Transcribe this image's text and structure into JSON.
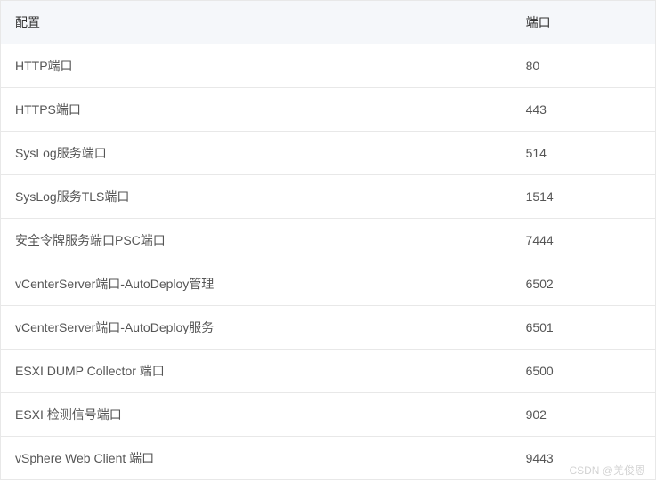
{
  "table": {
    "headers": {
      "config": "配置",
      "port": "端口"
    },
    "rows": [
      {
        "config": "HTTP端口",
        "port": "80"
      },
      {
        "config": "HTTPS端口",
        "port": "443"
      },
      {
        "config": "SysLog服务端口",
        "port": "514"
      },
      {
        "config": "SysLog服务TLS端口",
        "port": "1514"
      },
      {
        "config": "安全令牌服务端口PSC端口",
        "port": "7444"
      },
      {
        "config": "vCenterServer端口-AutoDeploy管理",
        "port": "6502"
      },
      {
        "config": "vCenterServer端口-AutoDeploy服务",
        "port": "6501"
      },
      {
        "config": "ESXI DUMP Collector 端口",
        "port": "6500"
      },
      {
        "config": "ESXI 检测信号端口",
        "port": "902"
      },
      {
        "config": "vSphere Web Client 端口",
        "port": "9443"
      }
    ]
  },
  "watermark": "CSDN @羌俊恩"
}
